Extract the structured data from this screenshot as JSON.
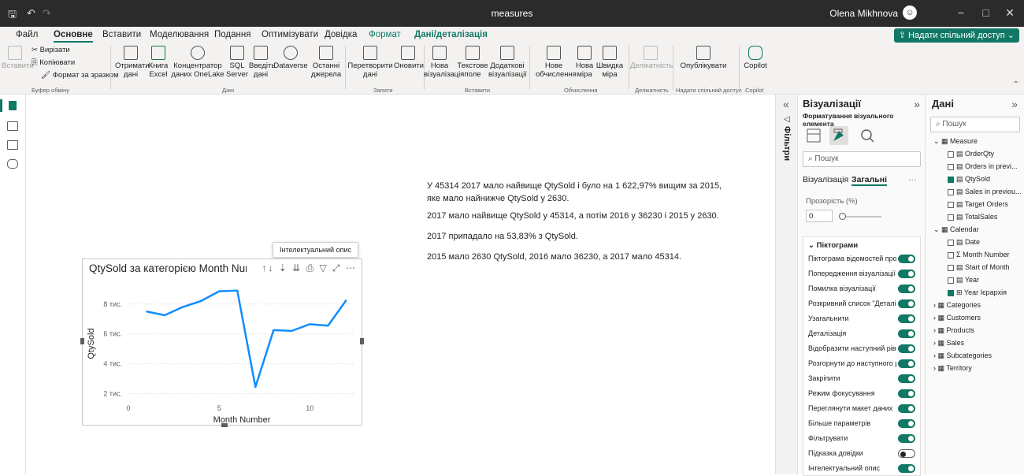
{
  "window": {
    "title": "measures",
    "user": "Olena Mikhnova",
    "minimize": "−",
    "maximize": "□",
    "close": "✕"
  },
  "menu": {
    "tabs": [
      "Файл",
      "Основне",
      "Вставити",
      "Моделювання",
      "Подання",
      "Оптимізувати",
      "Довідка",
      "Формат",
      "Дані/деталізація"
    ],
    "share_label": "Надати спільний доступ"
  },
  "ribbon": {
    "paste": "Вставити",
    "cut": "Вирізати",
    "copy": "Копіювати",
    "format_painter": "Формат за зразком",
    "clipboard_group": "Буфер обміну",
    "get_data": "Отримати дані",
    "excel": "Книга Excel",
    "onelake": "Концентратор даних OneLake",
    "sql": "SQL Server",
    "enter_data": "Введіть дані",
    "dataverse": "Dataverse",
    "recent": "Останні джерела",
    "data_group": "Дані",
    "transform": "Перетворити дані",
    "refresh": "Оновити",
    "queries_group": "Запити",
    "new_visual": "Нова візуалізація",
    "text_box": "Текстове поле",
    "more_visuals": "Додаткові візуалізації",
    "insert_group": "Вставити",
    "new_measure": "Нове обчислення",
    "quick_measure_new": "Нова міра",
    "quick_measure": "Швидка міра",
    "calc_group": "Обчислення",
    "sensitivity": "Делікатність",
    "sensitivity_group": "Делікатність",
    "publish": "Опублікувати",
    "share_group": "Надати спільний доступ",
    "copilot": "Copilot",
    "copilot_group": "Copilot"
  },
  "narrative": {
    "p1": "У 45314 2017 мало найвище QtySold і було на 1 622,97% вищим за 2015, яке мало найнижче QtySold у 2630.",
    "p2": "2017 мало найвище QtySold у 45314, а потім 2016 у 36230 і 2015 у 2630.",
    "p3": "2017 припадало на 53,83% з QtySold.",
    "p4": "2015 мало 2630 QtySold, 2016 мало 36230, а 2017 мало 45314."
  },
  "tooltip": "Інтелектуальний опис",
  "visual": {
    "title": "QtySold за категорією Month Number",
    "icons": "↑↓ ⇣ ⇊ ⎙ ▽ ⤢ ⋯"
  },
  "chart_data": {
    "type": "line",
    "title": "QtySold за категорією Month Number",
    "xlabel": "Month Number",
    "ylabel": "QtySold",
    "x": [
      1,
      2,
      3,
      4,
      5,
      6,
      7,
      8,
      9,
      10,
      11,
      12
    ],
    "series": [
      {
        "values": [
          7500,
          7250,
          7800,
          8200,
          8850,
          8900,
          2450,
          6250,
          6200,
          6650,
          6550,
          8250
        ]
      }
    ],
    "xticks": [
      "0",
      "5",
      "10"
    ],
    "xtick_values": [
      0,
      5,
      10
    ],
    "yticks": [
      "2 тис.",
      "4 тис.",
      "6 тис.",
      "8 тис."
    ],
    "ytick_values": [
      2000,
      4000,
      6000,
      8000
    ],
    "xlim": [
      0,
      12.5
    ],
    "ylim": [
      1500,
      9200
    ],
    "color": "#118DFF",
    "grid": true
  },
  "filters_label": "Фільтри",
  "vispane": {
    "title": "Візуалізації",
    "subtitle": "Форматування візуального елемента",
    "search": "Пошук",
    "tab1": "Візуалізація",
    "tab2": "Загальні",
    "more": "···",
    "transparency_label": "Прозорість (%)",
    "transparency_value": "0",
    "section": "Піктограми",
    "items": [
      {
        "label": "Піктограма відомостей про ві...",
        "on": true
      },
      {
        "label": "Попередження візуалізації",
        "on": true
      },
      {
        "label": "Помилка візуалізації",
        "on": true
      },
      {
        "label": "Розкривний список \"Деталізу...",
        "on": true
      },
      {
        "label": "Узагальнити",
        "on": true
      },
      {
        "label": "Деталізація",
        "on": true
      },
      {
        "label": "Відобразити наступний рівень",
        "on": true
      },
      {
        "label": "Розгорнути до наступного рів...",
        "on": true
      },
      {
        "label": "Закріпити",
        "on": true
      },
      {
        "label": "Режим фокусування",
        "on": true
      },
      {
        "label": "Переглянути макет даних",
        "on": true
      },
      {
        "label": "Більше параметрів",
        "on": true
      },
      {
        "label": "Фільтрувати",
        "on": true
      },
      {
        "label": "Підказка довідки",
        "on": false
      },
      {
        "label": "Інтелектуальний опис",
        "on": true
      }
    ]
  },
  "datapane": {
    "title": "Дані",
    "search": "Пошук",
    "tree": [
      {
        "label": "Measure",
        "level": 0,
        "type": "table-open"
      },
      {
        "label": "OrderQty",
        "level": 1,
        "check": false
      },
      {
        "label": "Orders in previ...",
        "level": 1,
        "check": false
      },
      {
        "label": "QtySold",
        "level": 1,
        "check": true
      },
      {
        "label": "Sales in previou...",
        "level": 1,
        "check": false
      },
      {
        "label": "Target Orders",
        "level": 1,
        "check": false
      },
      {
        "label": "TotalSales",
        "level": 1,
        "check": false
      },
      {
        "label": "Calendar",
        "level": 0,
        "type": "table-open"
      },
      {
        "label": "Date",
        "level": 1,
        "check": false
      },
      {
        "label": "Month Number",
        "level": 1,
        "check": false,
        "sigma": true
      },
      {
        "label": "Start of Month",
        "level": 1,
        "check": false
      },
      {
        "label": "Year",
        "level": 1,
        "check": false
      },
      {
        "label": "Year Ієрархія",
        "level": 1,
        "check": true,
        "hier": true
      },
      {
        "label": "Categories",
        "level": 0,
        "type": "table"
      },
      {
        "label": "Customers",
        "level": 0,
        "type": "table"
      },
      {
        "label": "Products",
        "level": 0,
        "type": "table"
      },
      {
        "label": "Sales",
        "level": 0,
        "type": "table"
      },
      {
        "label": "Subcategories",
        "level": 0,
        "type": "table"
      },
      {
        "label": "Territory",
        "level": 0,
        "type": "table"
      }
    ]
  }
}
